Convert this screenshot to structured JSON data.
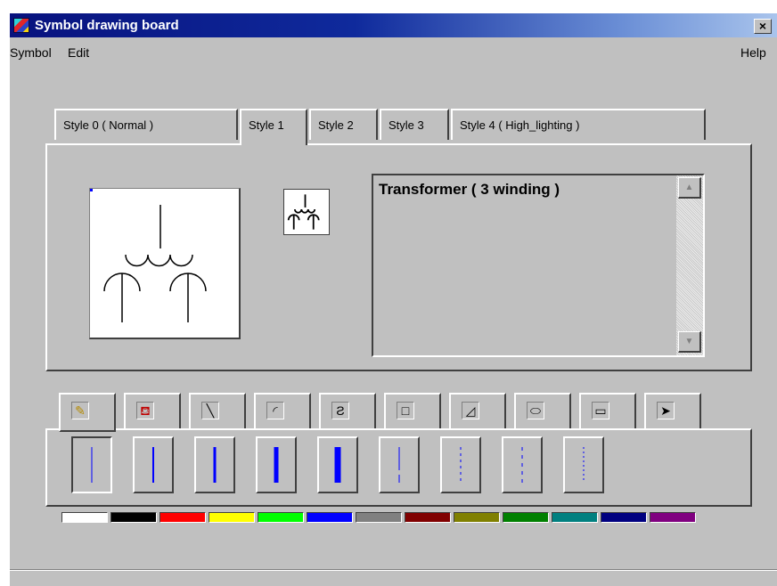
{
  "window": {
    "title": "Symbol drawing board",
    "close_label": "×"
  },
  "menu": {
    "left": [
      "Symbol",
      "Edit"
    ],
    "help": "Help"
  },
  "style_tabs": [
    "Style 0 ( Normal )",
    "Style 1",
    "Style 2",
    "Style 3",
    "Style 4 ( High_lighting )"
  ],
  "active_style_tab": "Style 1",
  "symbol": {
    "name": "Transformer ( 3 winding )",
    "scroll_up_icon": "arrow-up-icon",
    "scroll_down_icon": "arrow-down-icon"
  },
  "tool_tabs": [
    {
      "name": "pencil-icon",
      "glyph": "✎"
    },
    {
      "name": "fill-bucket-icon",
      "glyph": "⛾"
    },
    {
      "name": "line-icon",
      "glyph": "╲"
    },
    {
      "name": "arc-icon",
      "glyph": "◜"
    },
    {
      "name": "curve-icon",
      "glyph": "Ƨ"
    },
    {
      "name": "rectangle-icon",
      "glyph": "□"
    },
    {
      "name": "polygon-icon",
      "glyph": "◿"
    },
    {
      "name": "ellipse-icon",
      "glyph": "⬭"
    },
    {
      "name": "rounded-rectangle-icon",
      "glyph": "▭"
    },
    {
      "name": "pointer-icon",
      "glyph": "➤"
    }
  ],
  "selected_tool": "pencil-icon",
  "pen_styles": [
    {
      "style": "solid",
      "width": 1
    },
    {
      "style": "solid",
      "width": 2
    },
    {
      "style": "solid",
      "width": 3
    },
    {
      "style": "solid",
      "width": 5
    },
    {
      "style": "solid",
      "width": 7
    },
    {
      "style": "dash",
      "width": 1
    },
    {
      "style": "dot",
      "width": 1
    },
    {
      "style": "dashdot",
      "width": 1
    },
    {
      "style": "dot-dense",
      "width": 1
    }
  ],
  "selected_pen": 0,
  "pen_color": "#0000ff",
  "palette": [
    "#ffffff",
    "#000000",
    "#ff0000",
    "#ffff00",
    "#00ff00",
    "#0000ff",
    "#808080",
    "#800000",
    "#808000",
    "#008000",
    "#008080",
    "#000080",
    "#800080"
  ]
}
